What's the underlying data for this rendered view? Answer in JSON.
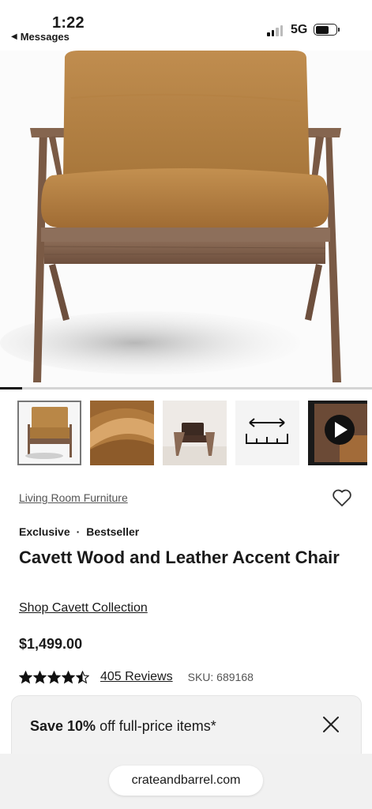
{
  "status": {
    "time": "1:22",
    "back_app": "Messages",
    "network": "5G",
    "battery_level": 0.65
  },
  "hero": {
    "image": "tan-leather-wood-accent-chair",
    "carousel_progress": 0.06
  },
  "thumbnails": [
    {
      "name": "chair-front",
      "active": true
    },
    {
      "name": "leather-closeup",
      "active": false
    },
    {
      "name": "chair-room",
      "active": false
    },
    {
      "name": "dimensions-icon",
      "active": false
    },
    {
      "name": "video-play",
      "active": false
    }
  ],
  "product": {
    "category": "Living Room Furniture",
    "tag1": "Exclusive",
    "tag_sep": "·",
    "tag2": "Bestseller",
    "title": "Cavett Wood and Leather Accent Chair",
    "collection_link": "Shop Cavett Collection",
    "price": "$1,499.00",
    "rating": 4.5,
    "reviews": "405 Reviews",
    "sku": "SKU: 689168"
  },
  "promo": {
    "bold": "Save 10%",
    "rest": " off full-price items*"
  },
  "browser": {
    "url": "crateandbarrel.com"
  },
  "colors": {
    "leather": "#b98747",
    "wood": "#7a5a45",
    "text": "#1a1a1a"
  }
}
